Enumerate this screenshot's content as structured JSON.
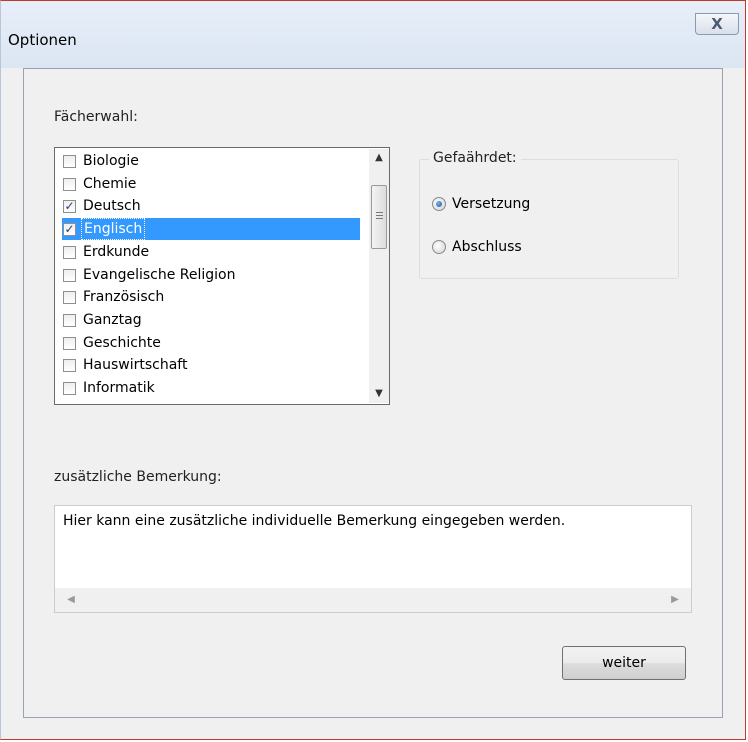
{
  "window": {
    "title": "Optionen",
    "close_label": "X"
  },
  "subjects": {
    "label": "Fächerwahl:",
    "items": [
      {
        "label": "Biologie",
        "checked": false,
        "selected": false
      },
      {
        "label": "Chemie",
        "checked": false,
        "selected": false
      },
      {
        "label": "Deutsch",
        "checked": true,
        "selected": false
      },
      {
        "label": "Englisch",
        "checked": true,
        "selected": true
      },
      {
        "label": "Erdkunde",
        "checked": false,
        "selected": false
      },
      {
        "label": "Evangelische Religion",
        "checked": false,
        "selected": false
      },
      {
        "label": "Französisch",
        "checked": false,
        "selected": false
      },
      {
        "label": "Ganztag",
        "checked": false,
        "selected": false
      },
      {
        "label": "Geschichte",
        "checked": false,
        "selected": false
      },
      {
        "label": "Hauswirtschaft",
        "checked": false,
        "selected": false
      },
      {
        "label": "Informatik",
        "checked": false,
        "selected": false
      }
    ]
  },
  "risk": {
    "title": "Gefaährdet:",
    "options": [
      {
        "label": "Versetzung",
        "checked": true
      },
      {
        "label": "Abschluss",
        "checked": false
      }
    ]
  },
  "remark": {
    "label": "zusätzliche Bemerkung:",
    "value": "Hier kann eine zusätzliche individuelle Bemerkung eingegeben werden."
  },
  "actions": {
    "next_label": "weiter"
  },
  "icons": {
    "checkmark": "✓",
    "scroll_up": "▲",
    "scroll_down": "▼",
    "scroll_left": "◀",
    "scroll_right": "▶"
  },
  "colors": {
    "selection": "#3399ff",
    "window_bg": "#f0f0f0"
  }
}
